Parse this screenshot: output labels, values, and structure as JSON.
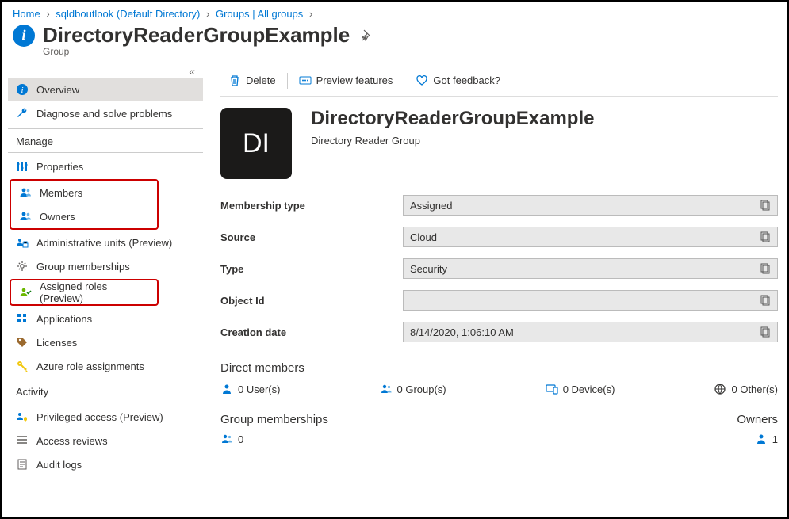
{
  "breadcrumb": {
    "home": "Home",
    "tenant": "sqldboutlook (Default Directory)",
    "groups": "Groups | All groups"
  },
  "header": {
    "title": "DirectoryReaderGroupExample",
    "subtype": "Group"
  },
  "sidebar": {
    "overview": "Overview",
    "diagnose": "Diagnose and solve problems",
    "sections": {
      "manage": "Manage",
      "activity": "Activity"
    },
    "manage": {
      "properties": "Properties",
      "members": "Members",
      "owners": "Owners",
      "admin_units": "Administrative units (Preview)",
      "group_memberships": "Group memberships",
      "assigned_roles": "Assigned roles (Preview)",
      "applications": "Applications",
      "licenses": "Licenses",
      "azure_role": "Azure role assignments"
    },
    "activity": {
      "privileged": "Privileged access (Preview)",
      "access_reviews": "Access reviews",
      "audit_logs": "Audit logs"
    }
  },
  "toolbar": {
    "delete": "Delete",
    "preview_features": "Preview features",
    "feedback": "Got feedback?"
  },
  "group": {
    "avatar_initials": "DI",
    "name": "DirectoryReaderGroupExample",
    "description": "Directory Reader Group"
  },
  "properties": {
    "labels": {
      "membership_type": "Membership type",
      "source": "Source",
      "type": "Type",
      "object_id": "Object Id",
      "creation_date": "Creation date"
    },
    "values": {
      "membership_type": "Assigned",
      "source": "Cloud",
      "type": "Security",
      "object_id": "",
      "creation_date": "8/14/2020, 1:06:10 AM"
    }
  },
  "direct_members": {
    "heading": "Direct members",
    "users": "0 User(s)",
    "groups": "0 Group(s)",
    "devices": "0 Device(s)",
    "others": "0 Other(s)"
  },
  "bottom": {
    "group_memberships_heading": "Group memberships",
    "group_memberships_count": "0",
    "owners_heading": "Owners",
    "owners_count": "1"
  }
}
